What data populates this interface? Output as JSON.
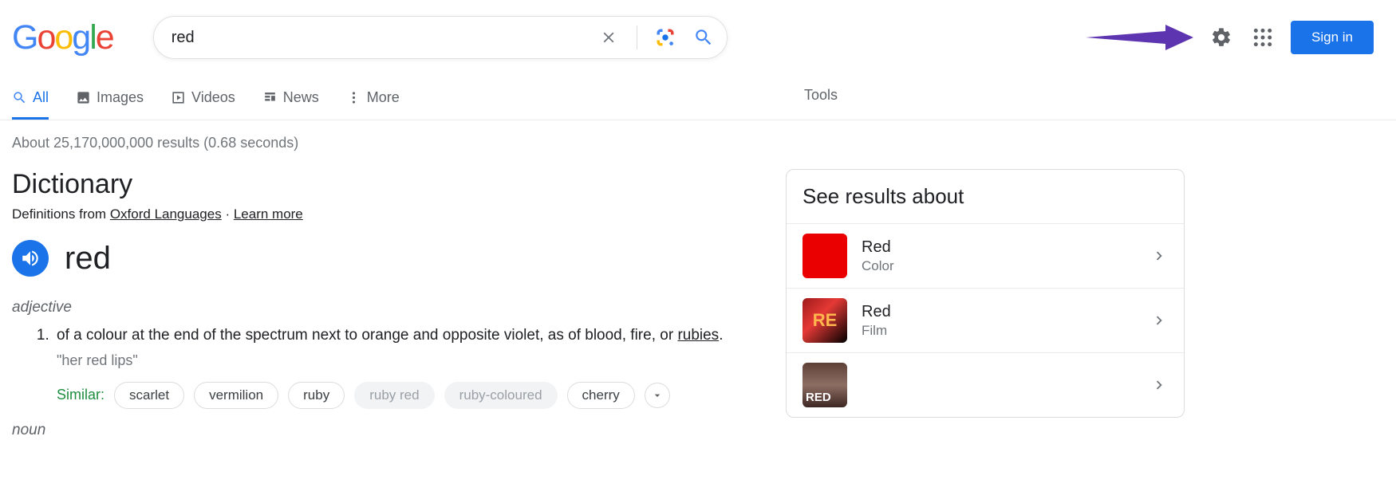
{
  "header": {
    "logo_letters": [
      "G",
      "o",
      "o",
      "g",
      "l",
      "e"
    ],
    "search_value": "red",
    "signin_label": "Sign in"
  },
  "tabs": {
    "items": [
      {
        "label": "All",
        "active": true
      },
      {
        "label": "Images"
      },
      {
        "label": "Videos"
      },
      {
        "label": "News"
      },
      {
        "label": "More"
      }
    ],
    "tools_label": "Tools"
  },
  "stats": "About 25,170,000,000 results (0.68 seconds)",
  "dictionary": {
    "title": "Dictionary",
    "source_prefix": "Definitions from ",
    "source_link": "Oxford Languages",
    "middot": " · ",
    "learn_more": "Learn more",
    "word": "red",
    "pos1": "adjective",
    "def1_pre": "of a colour at the end of the spectrum next to orange and opposite violet, as of blood, fire, or ",
    "def1_link": "rubies",
    "def1_post": ".",
    "example1": "\"her red lips\"",
    "similar_label": "Similar:",
    "similar": [
      "scarlet",
      "vermilion",
      "ruby",
      "ruby red",
      "ruby-coloured",
      "cherry"
    ],
    "pos2": "noun"
  },
  "side": {
    "title": "See results about",
    "items": [
      {
        "title": "Red",
        "subtitle": "Color"
      },
      {
        "title": "Red",
        "subtitle": "Film"
      },
      {
        "title": "",
        "subtitle": ""
      }
    ]
  }
}
